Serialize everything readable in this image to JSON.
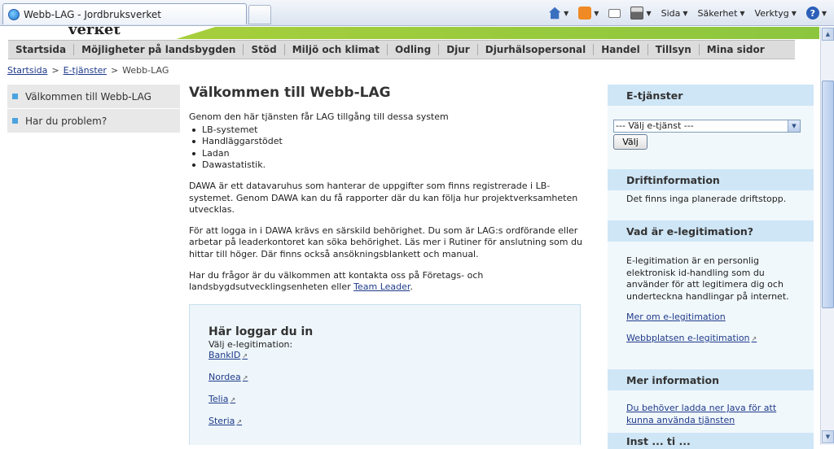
{
  "browser": {
    "tab_title": "Webb-LAG - Jordbruksverket",
    "commands": {
      "page": "Sida",
      "safety": "Säkerhet",
      "tools": "Verktyg"
    }
  },
  "site": {
    "logo_fragment": "verket",
    "main_nav": [
      "Startsida",
      "Möjligheter på landsbygden",
      "Stöd",
      "Miljö och klimat",
      "Odling",
      "Djur",
      "Djurhälsopersonal",
      "Handel",
      "Tillsyn",
      "Mina sidor"
    ],
    "breadcrumb": {
      "home": "Startsida",
      "sep": ">",
      "etjanster": "E-tjänster",
      "current": "Webb-LAG"
    },
    "left_nav": [
      "Välkommen till Webb-LAG",
      "Har du problem?"
    ],
    "content": {
      "title": "Välkommen till Webb-LAG",
      "intro": "Genom den här tjänsten får LAG tillgång till dessa system",
      "systems": [
        "LB-systemet",
        "Handläggarstödet",
        "Ladan",
        "Dawastatistik."
      ],
      "p1": "DAWA är ett datavaruhus som hanterar de uppgifter som finns registrerade i LB-systemet. Genom DAWA kan du få rapporter där du kan följa hur projektverksamheten utvecklas.",
      "p2": "För att logga in i DAWA krävs en särskild behörighet. Du som är LAG:s ordförande eller arbetar på leaderkontoret kan söka behörighet. Läs mer i Rutiner för anslutning som du hittar till höger. Där finns också ansökningsblankett och manual.",
      "p3_prefix": "Har du frågor är du välkommen att kontakta oss på Företags- och landsbygdsutvecklingsenheten eller ",
      "p3_link": "Team Leader",
      "p3_suffix": "."
    },
    "login": {
      "title": "Här loggar du in",
      "subtitle": "Välj e-legitimation:",
      "options": [
        "BankID",
        "Nordea",
        "Telia",
        "Steria"
      ]
    },
    "right": {
      "etjanster": {
        "title": "E-tjänster",
        "select_value": "--- Välj e-tjänst ---",
        "button": "Välj"
      },
      "drift": {
        "title": "Driftinformation",
        "text": "Det finns inga planerade driftstopp."
      },
      "eleg": {
        "title": "Vad är e-legitimation?",
        "text": "E-legitimation är en personlig elektronisk id-handling som du använder för att legitimera dig och underteckna handlingar på internet.",
        "link1": "Mer om e-legitimation",
        "link2": "Webbplatsen e-legitimation"
      },
      "mer": {
        "title": "Mer information",
        "link": "Du behöver ladda ner Java för att kunna använda tjänsten"
      },
      "last_title": "Inst ... ti ..."
    }
  }
}
